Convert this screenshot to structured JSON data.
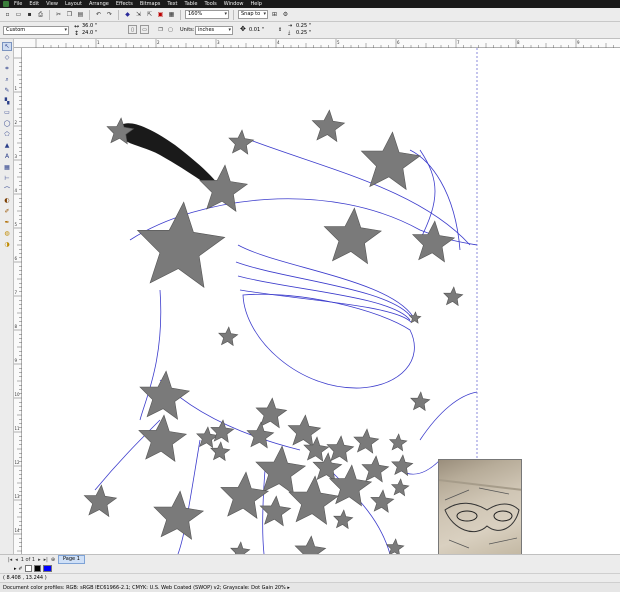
{
  "menu": {
    "items": [
      "File",
      "Edit",
      "View",
      "Layout",
      "Arrange",
      "Effects",
      "Bitmaps",
      "Text",
      "Table",
      "Tools",
      "Window",
      "Help"
    ]
  },
  "toolbar": {
    "zoom_value": "160%",
    "snap_to_label": "Snap to"
  },
  "property_bar": {
    "page_preset": "Custom",
    "page_width": "36.0 \"",
    "page_height": "24.0 \"",
    "units_label": "Units:",
    "units_value": "inches",
    "nudge_value": "0.01 \"",
    "dup_x": "0.25 \"",
    "dup_y": "0.25 \""
  },
  "rulers": {
    "horizontal_ticks": [
      "1",
      "2",
      "3",
      "4",
      "5",
      "6",
      "7",
      "8",
      "9",
      "10"
    ],
    "vertical_ticks": [
      "1",
      "2",
      "3",
      "4",
      "5",
      "6",
      "7",
      "8",
      "9",
      "10",
      "11",
      "12",
      "13",
      "14",
      "15"
    ]
  },
  "page_nav": {
    "page_counter": "1 of 1",
    "page_tab_label": "Page 1"
  },
  "status": {
    "coordinates": "( 8.408 , 13.244 )",
    "color_profiles": "Document color profiles: RGB: sRGB IEC61966-2.1; CMYK: U.S. Web Coated (SWOP) v2; Grayscale: Dot Gain 20%"
  },
  "colors": {
    "star_fill": "#7a7a7a",
    "star_outline": "#555555",
    "outline_blue": "#3c3ccc",
    "stroke_black": "#1a1a1a",
    "swatch_blue": "#0000ff",
    "palette_black": "#000000"
  },
  "icons": [
    "pick-tool-icon",
    "shape-tool-icon",
    "crop-tool-icon",
    "zoom-tool-icon",
    "freehand-tool-icon",
    "rectangle-tool-icon",
    "ellipse-tool-icon",
    "polygon-tool-icon",
    "text-tool-icon",
    "fill-tool-icon",
    "outline-tool-icon",
    "new-icon",
    "open-icon",
    "save-icon",
    "print-icon",
    "undo-icon",
    "redo-icon",
    "import-icon",
    "export-icon",
    "options-icon"
  ]
}
